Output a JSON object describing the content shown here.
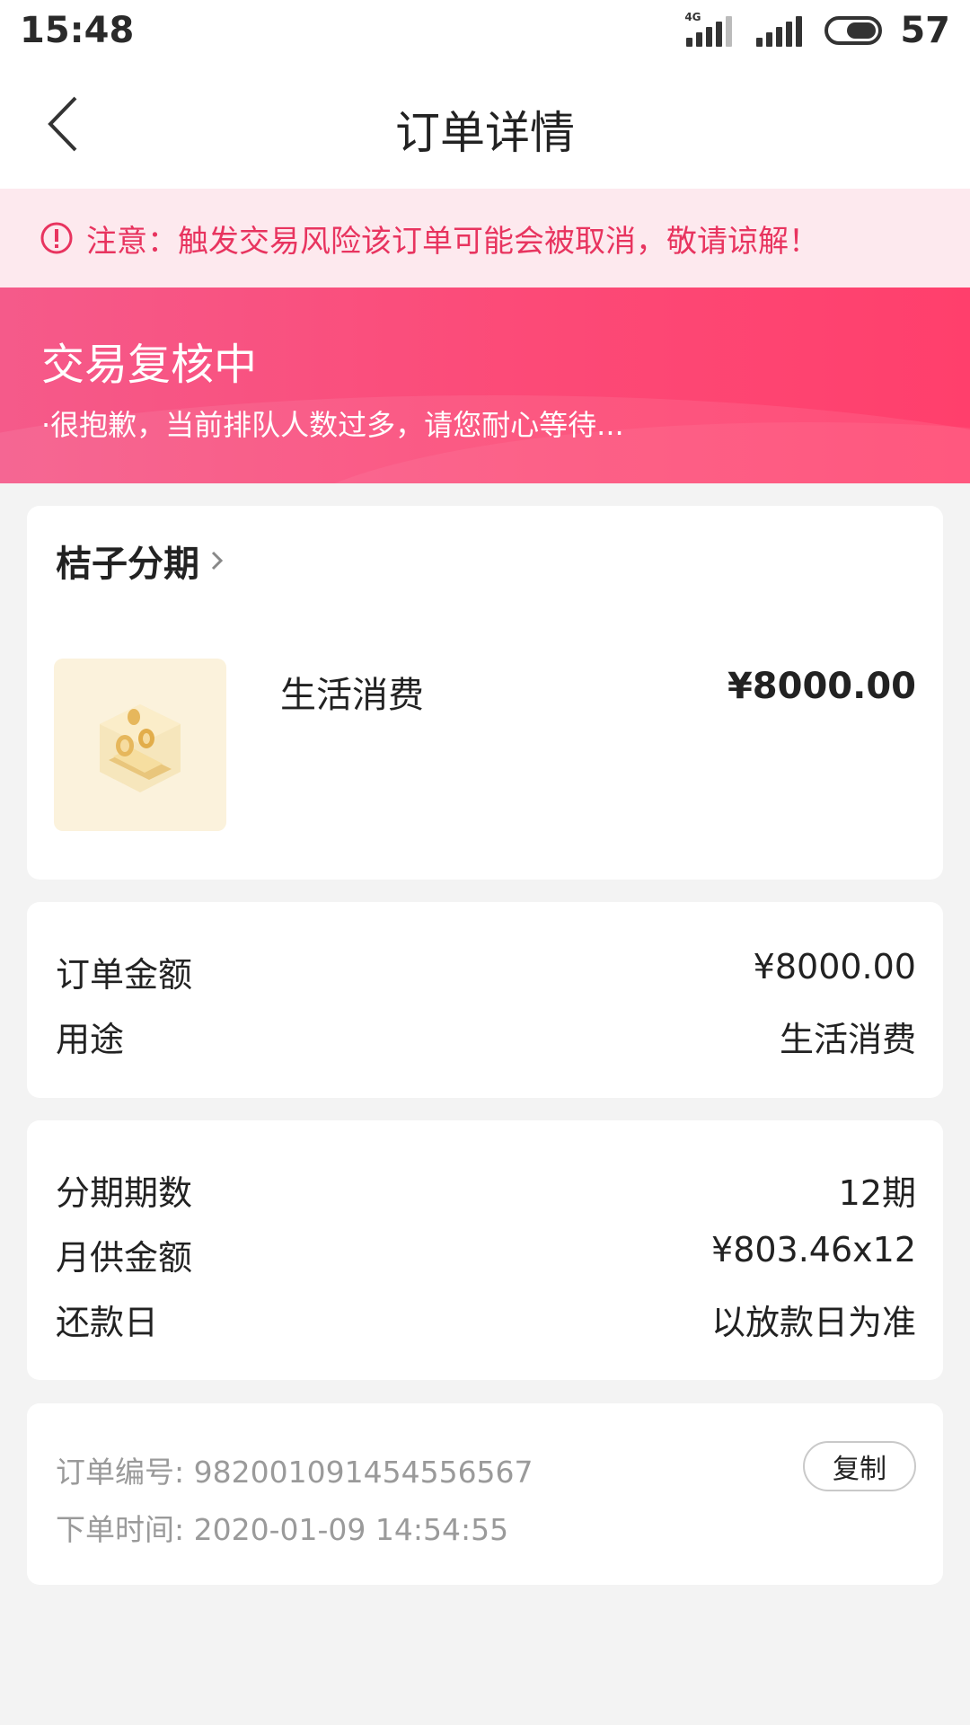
{
  "status_bar": {
    "time": "15:48",
    "network_label": "4G",
    "battery": "57"
  },
  "header": {
    "title": "订单详情"
  },
  "notice": {
    "text": "注意：触发交易风险该订单可能会被取消，敬请谅解！",
    "color": "#e8345f"
  },
  "status_banner": {
    "title": "交易复核中",
    "subtitle": "·很抱歉，当前排队人数过多，请您耐心等待..."
  },
  "product": {
    "brand": "桔子分期",
    "name": "生活消费",
    "price": "¥8000.00"
  },
  "order_summary": [
    {
      "label": "订单金额",
      "value": "¥8000.00"
    },
    {
      "label": "用途",
      "value": "生活消费"
    }
  ],
  "installment": [
    {
      "label": "分期期数",
      "value": "12期"
    },
    {
      "label": "月供金额",
      "value": "¥803.46x12"
    },
    {
      "label": "还款日",
      "value": "以放款日为准"
    }
  ],
  "order_info": {
    "order_no_label": "订单编号:",
    "order_no": "982001091454556567",
    "time_label": "下单时间:",
    "time": "2020-01-09 14:54:55",
    "copy_label": "复制"
  },
  "colors": {
    "accent": "#fc4a77",
    "notice_bg": "#fde9ee",
    "page_bg": "#f3f3f3"
  }
}
